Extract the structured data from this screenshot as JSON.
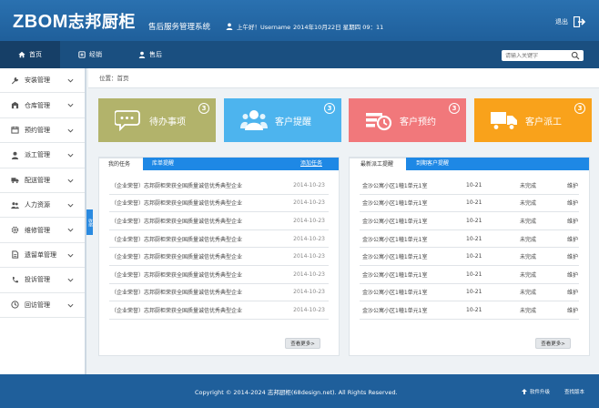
{
  "header": {
    "brand_en": "ZBOM",
    "brand_cn": "志邦厨柜",
    "system_title": "售后服务管理系统",
    "greeting": "上午好！Username",
    "date": "2014年10月22日  星期四  09：11",
    "logout_label": "退出"
  },
  "nav": {
    "tabs": [
      {
        "label": "首页"
      },
      {
        "label": "经销"
      },
      {
        "label": "售后"
      }
    ],
    "search_placeholder": "请输入关键字"
  },
  "sidebar": {
    "items": [
      {
        "label": "安装管理"
      },
      {
        "label": "仓库管理"
      },
      {
        "label": "预约管理"
      },
      {
        "label": "派工管理"
      },
      {
        "label": "配送管理"
      },
      {
        "label": "人力资源"
      },
      {
        "label": "维修管理"
      },
      {
        "label": "遗留单管理"
      },
      {
        "label": "投诉管理"
      },
      {
        "label": "回访管理"
      }
    ],
    "collapse_label": "收缩"
  },
  "breadcrumb": "位置：首页",
  "cards": [
    {
      "label": "待办事项",
      "count": "3",
      "color": "#b2b36b"
    },
    {
      "label": "客户提醒",
      "count": "3",
      "color": "#4db4ee"
    },
    {
      "label": "客户预约",
      "count": "3",
      "color": "#f1787b"
    },
    {
      "label": "客户派工",
      "count": "3",
      "color": "#f9a21b"
    }
  ],
  "left_panel": {
    "tab_active": "我的任务",
    "tab_other": "库单提醒",
    "tab_more": "添加任务",
    "rows": [
      {
        "title": "（企业荣誉）志邦厨柜荣获全国质量诚信优秀典型企业",
        "date": "2014-10-23"
      },
      {
        "title": "（企业荣誉）志邦厨柜荣获全国质量诚信优秀典型企业",
        "date": "2014-10-23"
      },
      {
        "title": "（企业荣誉）志邦厨柜荣获全国质量诚信优秀典型企业",
        "date": "2014-10-23"
      },
      {
        "title": "（企业荣誉）志邦厨柜荣获全国质量诚信优秀典型企业",
        "date": "2014-10-23"
      },
      {
        "title": "（企业荣誉）志邦厨柜荣获全国质量诚信优秀典型企业",
        "date": "2014-10-23"
      },
      {
        "title": "（企业荣誉）志邦厨柜荣获全国质量诚信优秀典型企业",
        "date": "2014-10-23"
      },
      {
        "title": "（企业荣誉）志邦厨柜荣获全国质量诚信优秀典型企业",
        "date": "2014-10-23"
      },
      {
        "title": "（企业荣誉）志邦厨柜荣获全国质量诚信优秀典型企业",
        "date": "2014-10-23"
      }
    ],
    "more_label": "查看更多>"
  },
  "right_panel": {
    "tab_active": "最新派工提醒",
    "tab_other": "到期客户提醒",
    "rows": [
      {
        "addr": "金沙公寓小区1幢1单元1室",
        "date": "10-21",
        "status": "未完成",
        "type": "维护"
      },
      {
        "addr": "金沙公寓小区1幢1单元1室",
        "date": "10-21",
        "status": "未完成",
        "type": "维护"
      },
      {
        "addr": "金沙公寓小区1幢1单元1室",
        "date": "10-21",
        "status": "未完成",
        "type": "维护"
      },
      {
        "addr": "金沙公寓小区1幢1单元1室",
        "date": "10-21",
        "status": "未完成",
        "type": "维护"
      },
      {
        "addr": "金沙公寓小区1幢1单元1室",
        "date": "10-21",
        "status": "未完成",
        "type": "维护"
      },
      {
        "addr": "金沙公寓小区1幢1单元1室",
        "date": "10-21",
        "status": "未完成",
        "type": "维护"
      },
      {
        "addr": "金沙公寓小区1幢1单元1室",
        "date": "10-21",
        "status": "未完成",
        "type": "维护"
      },
      {
        "addr": "金沙公寓小区1幢1单元1室",
        "date": "10-21",
        "status": "未完成",
        "type": "维护"
      }
    ],
    "more_label": "查看更多>"
  },
  "footer": {
    "copyright": "Copyright © 2014-2024 志邦厨柜(68design.net). All Rights Reserved.",
    "upgrade_label": "软件升级",
    "version_label": "查找版本"
  }
}
